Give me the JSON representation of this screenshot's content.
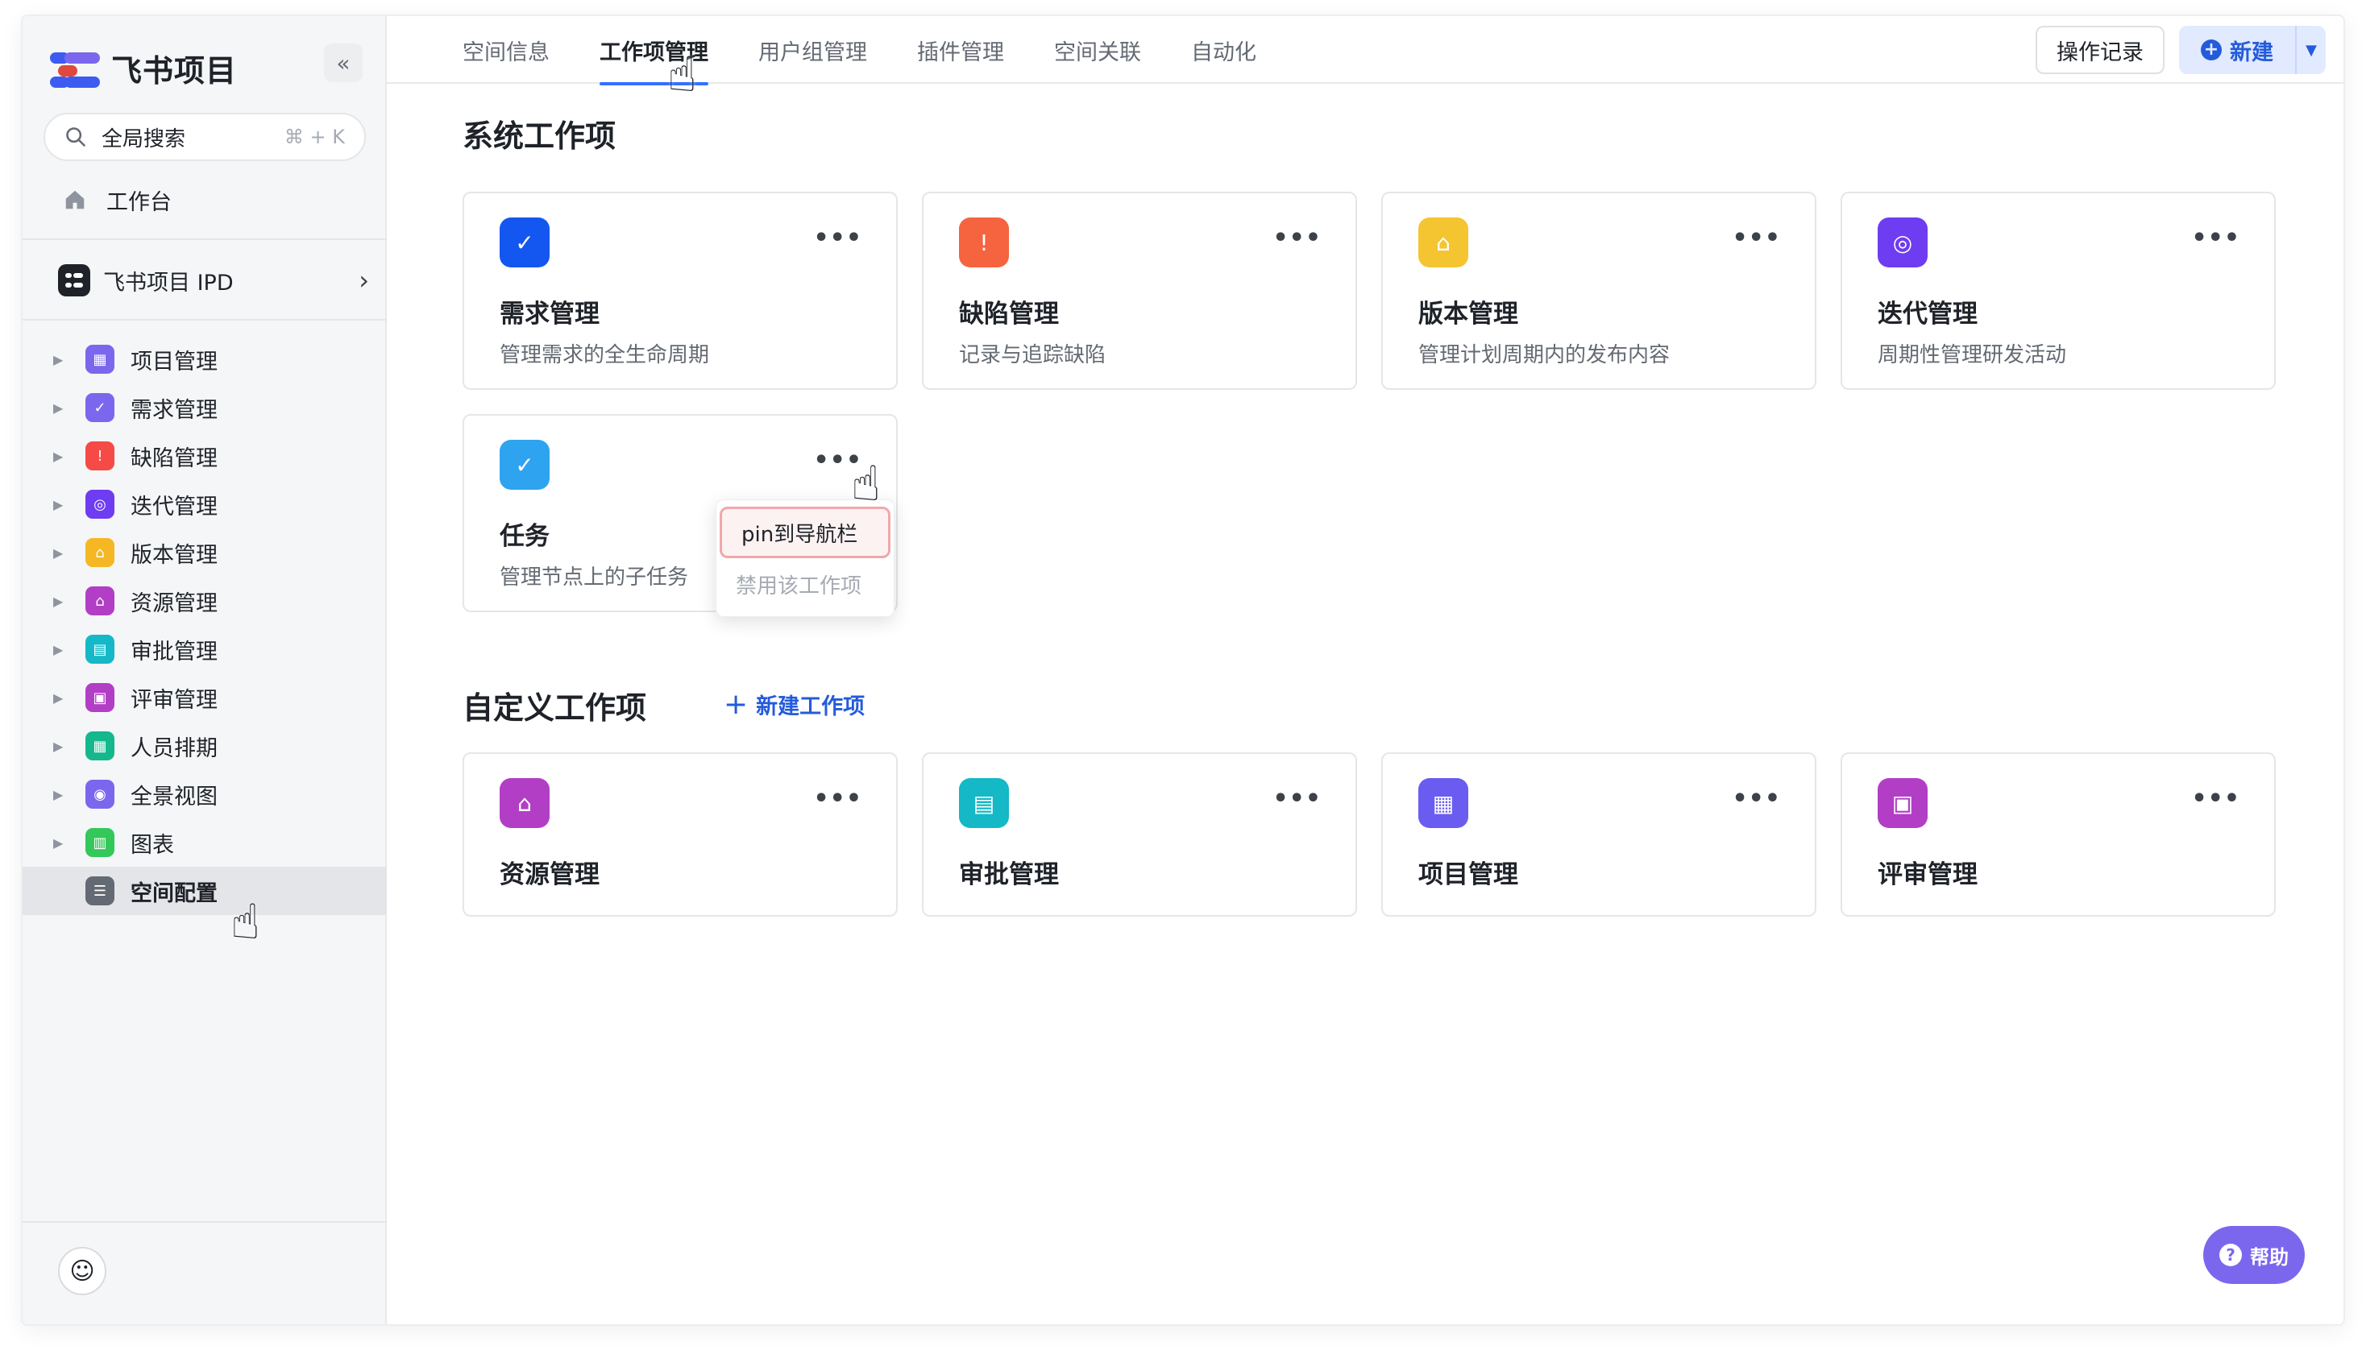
{
  "app": {
    "title": "飞书项目"
  },
  "sidebar": {
    "collapse_icon": "«",
    "search": {
      "placeholder": "全局搜索",
      "shortcut": "⌘ + K"
    },
    "workbench_label": "工作台",
    "space": {
      "name": "飞书项目 IPD"
    },
    "items": [
      {
        "label": "项目管理",
        "icon": "grid-icon",
        "color": "#7b67ee"
      },
      {
        "label": "需求管理",
        "icon": "check-icon",
        "color": "#7b67ee"
      },
      {
        "label": "缺陷管理",
        "icon": "alert-icon",
        "color": "#f54a45"
      },
      {
        "label": "迭代管理",
        "icon": "cycle-icon",
        "color": "#6e3cf1"
      },
      {
        "label": "版本管理",
        "icon": "bookmark-icon",
        "color": "#f5b824"
      },
      {
        "label": "资源管理",
        "icon": "bookmark-icon",
        "color": "#b23ec6"
      },
      {
        "label": "审批管理",
        "icon": "approve-icon",
        "color": "#14b8c6"
      },
      {
        "label": "评审管理",
        "icon": "review-icon",
        "color": "#b23ec6"
      },
      {
        "label": "人员排期",
        "icon": "calendar-icon",
        "color": "#14b88c"
      },
      {
        "label": "全景视图",
        "icon": "panorama-icon",
        "color": "#7b67ee"
      },
      {
        "label": "图表",
        "icon": "chart-icon",
        "color": "#34c759"
      },
      {
        "label": "空间配置",
        "icon": "settings-icon",
        "color": "#646a73"
      }
    ]
  },
  "topbar": {
    "tabs": [
      "空间信息",
      "工作项管理",
      "用户组管理",
      "插件管理",
      "空间关联",
      "自动化"
    ],
    "active_tab": "工作项管理",
    "oplog_label": "操作记录",
    "new_label": "新建"
  },
  "system_section": {
    "title": "系统工作项",
    "cards": [
      {
        "title": "需求管理",
        "desc": "管理需求的全生命周期",
        "color": "#1456f0"
      },
      {
        "title": "缺陷管理",
        "desc": "记录与追踪缺陷",
        "color": "#f5633f"
      },
      {
        "title": "版本管理",
        "desc": "管理计划周期内的发布内容",
        "color": "#f5c431"
      },
      {
        "title": "迭代管理",
        "desc": "周期性管理研发活动",
        "color": "#6e3cf1"
      },
      {
        "title": "任务",
        "desc": "管理节点上的子任务",
        "color": "#2ea4f0"
      }
    ]
  },
  "context_menu": {
    "items": [
      "pin到导航栏",
      "禁用该工作项"
    ]
  },
  "custom_section": {
    "title": "自定义工作项",
    "add_label": "新建工作项",
    "cards": [
      {
        "title": "资源管理",
        "color": "#b23ec6"
      },
      {
        "title": "审批管理",
        "color": "#14b8c6"
      },
      {
        "title": "项目管理",
        "color": "#6a5cf0"
      },
      {
        "title": "评审管理",
        "color": "#b23ec6"
      }
    ]
  },
  "help": {
    "label": "帮助"
  }
}
